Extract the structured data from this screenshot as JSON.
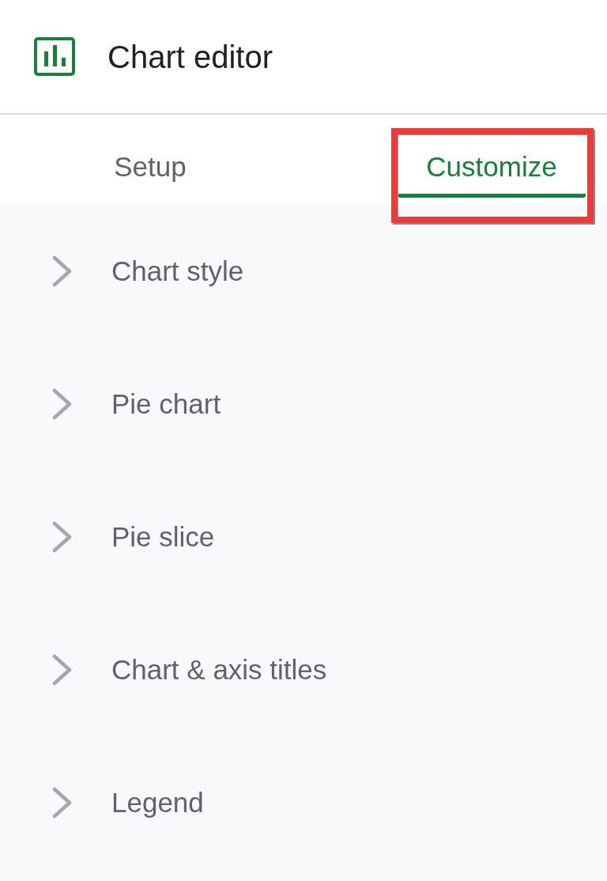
{
  "header": {
    "title": "Chart editor"
  },
  "tabs": [
    {
      "label": "Setup",
      "selected": false,
      "highlighted": false
    },
    {
      "label": "Customize",
      "selected": true,
      "highlighted": true
    }
  ],
  "sections": [
    {
      "label": "Chart style",
      "expanded": false
    },
    {
      "label": "Pie chart",
      "expanded": false
    },
    {
      "label": "Pie slice",
      "expanded": false
    },
    {
      "label": "Chart & axis titles",
      "expanded": false
    },
    {
      "label": "Legend",
      "expanded": false
    }
  ]
}
